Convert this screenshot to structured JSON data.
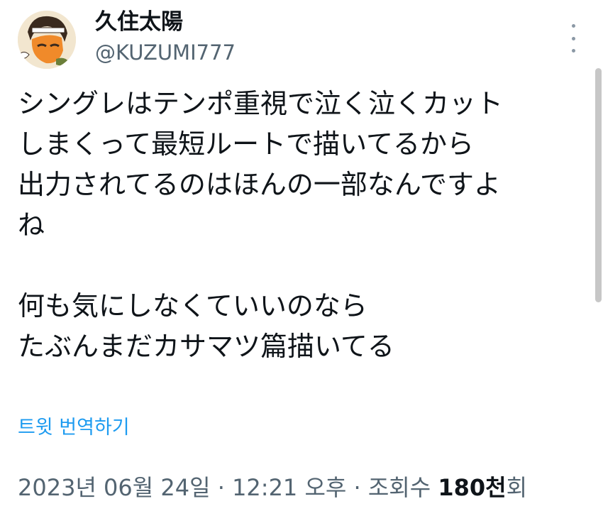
{
  "author": {
    "display_name": "久住太陽",
    "handle": "@KUZUMI777"
  },
  "tweet": {
    "lines": [
      "シングレはテンポ重視で泣く泣くカット",
      "しまくって最短ルートで描いてるから",
      "出力されてるのはほんの一部なんですよ",
      "ね",
      "",
      "何も気にしなくていいのなら",
      "たぶんまだカサマツ篇描いてる"
    ],
    "translate_label": "트윗 번역하기"
  },
  "meta": {
    "date": "2023년 06월 24일",
    "separator": "·",
    "time": "12:21 오후",
    "views_label": "조회수",
    "views_count": "180천",
    "views_suffix": "회"
  },
  "icons": {
    "more": "more-vertical-icon"
  }
}
